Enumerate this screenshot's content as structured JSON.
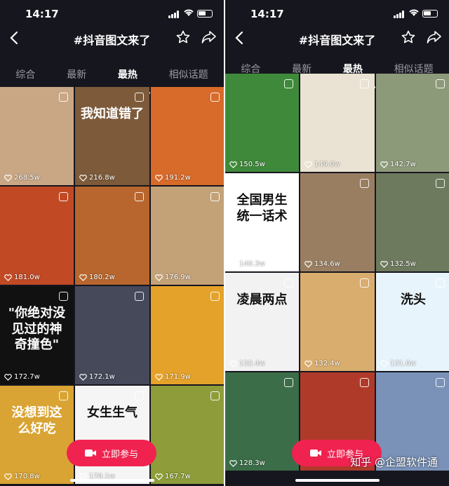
{
  "left": {
    "status": {
      "time": "14:17"
    },
    "header": {
      "title": "#抖音图文来了"
    },
    "tabs": [
      "综合",
      "最新",
      "最热",
      "相似话题"
    ],
    "active_tab": 2,
    "cells": [
      {
        "likes": "268.5w",
        "bg": "#c9a785",
        "caption": ""
      },
      {
        "likes": "216.8w",
        "bg": "#7c5a3a",
        "caption": "我知道错了"
      },
      {
        "likes": "191.2w",
        "bg": "#d86a2a",
        "caption": ""
      },
      {
        "likes": "181.0w",
        "bg": "#c14a25",
        "caption": ""
      },
      {
        "likes": "180.2w",
        "bg": "#b8662e",
        "caption": ""
      },
      {
        "likes": "176.9w",
        "bg": "#c4a278",
        "caption": ""
      },
      {
        "likes": "172.7w",
        "bg": "#111111",
        "caption": "\"你绝对没见过的神奇撞色\""
      },
      {
        "likes": "172.1w",
        "bg": "#45495a",
        "caption": ""
      },
      {
        "likes": "171.9w",
        "bg": "#e5a22a",
        "caption": ""
      },
      {
        "likes": "170.8w",
        "bg": "#d9a434",
        "caption": "没想到这么好吃"
      },
      {
        "likes": "170.1w",
        "bg": "#f5f5f5",
        "caption": "女生生气"
      },
      {
        "likes": "167.7w",
        "bg": "#8e9d3a",
        "caption": ""
      }
    ],
    "fab_label": "立即参与"
  },
  "right": {
    "status": {
      "time": "14:17"
    },
    "header": {
      "title": "#抖音图文来了"
    },
    "tabs": [
      "综合",
      "最新",
      "最热",
      "相似话题"
    ],
    "active_tab": 2,
    "cells": [
      {
        "likes": "150.5w",
        "bg": "#3f8a3a",
        "caption": ""
      },
      {
        "likes": "149.0w",
        "bg": "#eae2d2",
        "caption": ""
      },
      {
        "likes": "142.7w",
        "bg": "#8d9a7a",
        "caption": ""
      },
      {
        "likes": "140.3w",
        "bg": "#ffffff",
        "caption": "全国男生统一话术"
      },
      {
        "likes": "134.6w",
        "bg": "#9a7e62",
        "caption": ""
      },
      {
        "likes": "132.5w",
        "bg": "#6e7a5e",
        "caption": ""
      },
      {
        "likes": "132.4w",
        "bg": "#f2f2f2",
        "caption": "凌晨两点"
      },
      {
        "likes": "132.4w",
        "bg": "#d9ad6e",
        "caption": ""
      },
      {
        "likes": "131.0w",
        "bg": "#e8f4fb",
        "caption": "洗头"
      },
      {
        "likes": "128.3w",
        "bg": "#3a6d48",
        "caption": ""
      },
      {
        "likes": "",
        "bg": "#b03a2a",
        "caption": ""
      },
      {
        "likes": "",
        "bg": "#7a92b8",
        "caption": ""
      }
    ],
    "fab_label": "立即参与",
    "watermark": "知乎 @企盟软件通"
  }
}
